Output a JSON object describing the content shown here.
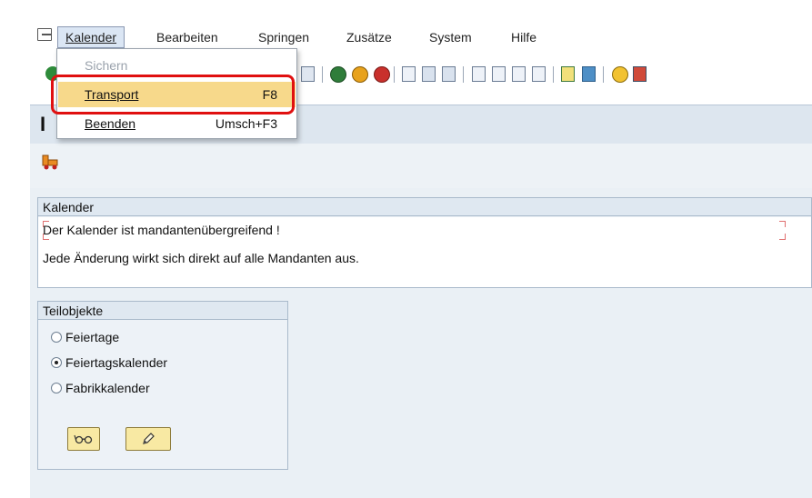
{
  "menubar": {
    "items": [
      {
        "label": "Kalender"
      },
      {
        "label": "Bearbeiten"
      },
      {
        "label": "Springen"
      },
      {
        "label": "Zusätze"
      },
      {
        "label": "System"
      },
      {
        "label": "Hilfe"
      }
    ]
  },
  "dropdown": {
    "items": [
      {
        "label": "Sichern",
        "shortcut": "",
        "enabled": false
      },
      {
        "label": "Transport",
        "shortcut": "F8",
        "enabled": true,
        "highlighted": true
      },
      {
        "label": "Beenden",
        "shortcut": "Umsch+F3",
        "enabled": true
      }
    ]
  },
  "title": {
    "glyph": "I"
  },
  "kalender_box": {
    "heading": "Kalender",
    "lines": [
      "Der Kalender ist mandantenübergreifend !",
      "Jede Änderung wirkt sich direkt auf alle Mandanten aus."
    ]
  },
  "teilobjekte_box": {
    "heading": "Teilobjekte",
    "options": [
      {
        "label": "Feiertage",
        "selected": false
      },
      {
        "label": "Feiertagskalender",
        "selected": true
      },
      {
        "label": "Fabrikkalender",
        "selected": false
      }
    ],
    "buttons": [
      {
        "icon": "glasses-icon"
      },
      {
        "icon": "pencil-icon"
      }
    ]
  },
  "toolbar": {
    "icons": [
      "enter-icon",
      "save-icon",
      "back-icon",
      "exit-icon",
      "cancel-icon",
      "print-icon",
      "find-icon",
      "find-next-icon",
      "first-page-icon",
      "previous-page-icon",
      "next-page-icon",
      "last-page-icon",
      "new-session-icon",
      "shortcut-icon",
      "help-icon",
      "layout-icon"
    ]
  },
  "colors": {
    "highlight_frame": "#e01010",
    "menu_selection": "#f7d98b",
    "button_yellow": "#f8e9a3"
  }
}
